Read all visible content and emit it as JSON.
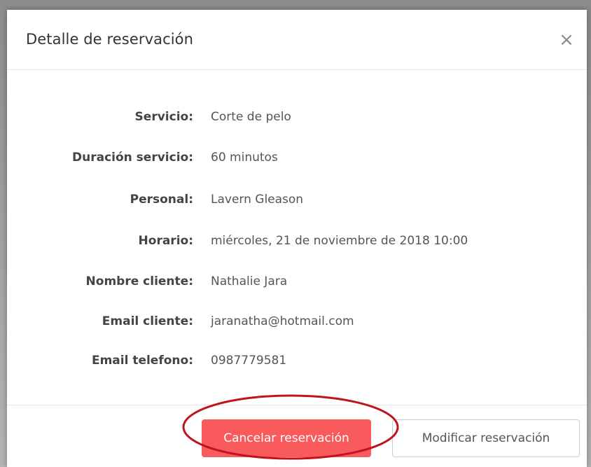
{
  "modal": {
    "title": "Detalle de reservación",
    "close_glyph": "×"
  },
  "details": [
    {
      "label": "Servicio:",
      "value": "Corte de pelo"
    },
    {
      "label": "Duración servicio:",
      "value": "60 minutos"
    },
    {
      "label": "Personal:",
      "value": "Lavern Gleason"
    },
    {
      "label": "Horario:",
      "value": "miércoles, 21 de noviembre de 2018 10:00"
    },
    {
      "label": "Nombre cliente:",
      "value": "Nathalie Jara"
    },
    {
      "label": "Email cliente:",
      "value": "jaranatha@hotmail.com"
    },
    {
      "label": "Email telefono:",
      "value": "0987779581"
    }
  ],
  "footer": {
    "cancel_label": "Cancelar reservación",
    "modify_label": "Modificar reservación"
  },
  "colors": {
    "danger": "#f95a5c",
    "annotation": "#c0141c"
  },
  "icons": {
    "close": "close-icon"
  }
}
